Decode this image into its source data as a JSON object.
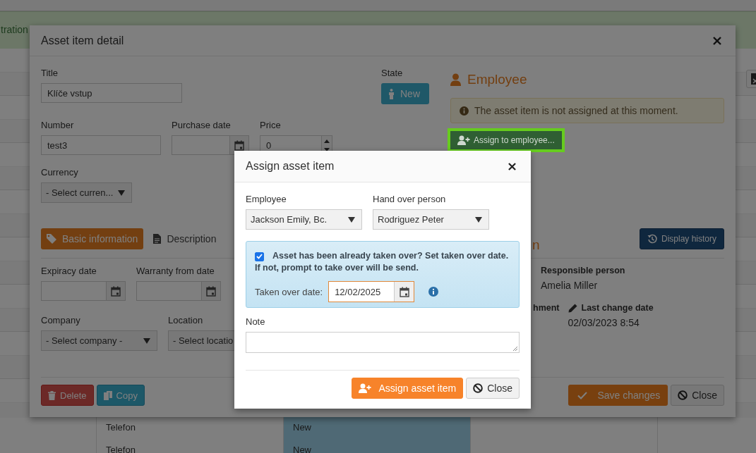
{
  "background": {
    "banner_text": "tration",
    "table_rows": [
      {
        "name": "Telefon",
        "state": "New"
      },
      {
        "name": "Telefon",
        "state": "New"
      }
    ]
  },
  "detail": {
    "title": "Asset item detail",
    "title_field": {
      "label": "Title",
      "value": "Klíče vstup"
    },
    "state": {
      "label": "State",
      "value": "New"
    },
    "number": {
      "label": "Number",
      "value": "test3"
    },
    "purchase_date": {
      "label": "Purchase date"
    },
    "price": {
      "label": "Price",
      "value": "0"
    },
    "currency": {
      "label": "Currency",
      "value": "- Select curren..."
    },
    "employee": {
      "heading": "Employee",
      "alert": "The asset item is not assigned at this moment.",
      "assign_button": "Assign to employee...",
      "highlighted": true
    },
    "tabs": [
      {
        "label": "Basic information",
        "selected": true
      },
      {
        "label": "Description",
        "selected": false
      }
    ],
    "history_button": "Display history",
    "dates": [
      {
        "label": "Expiracy date"
      },
      {
        "label": "Warranty from date"
      }
    ],
    "company": {
      "label": "Company",
      "value": "- Select company -"
    },
    "location": {
      "label": "Location",
      "value": "- Select locatio"
    },
    "section_heading": "n",
    "responsible": {
      "label": "Responsible person",
      "value": "Amelia Miller"
    },
    "attachment_label": "hment",
    "last_change": {
      "label": "Last change date",
      "value": "02/03/2023 8:54"
    },
    "buttons": {
      "delete": "Delete",
      "copy": "Copy",
      "save": "Save changes",
      "close": "Close"
    }
  },
  "assign": {
    "title": "Assign asset item",
    "employee": {
      "label": "Employee",
      "value": "Jackson Emily, Bc."
    },
    "hand_over": {
      "label": "Hand over person",
      "value": "Rodriguez Peter"
    },
    "taken_over": {
      "checked": true,
      "lines": [
        "Asset has been already taken over? Set taken over date.",
        "If not, prompt to take over will be send."
      ],
      "date_label": "Taken over date:",
      "date_value": "12/02/2025"
    },
    "note": {
      "label": "Note"
    },
    "buttons": {
      "assign": "Assign asset item",
      "close": "Close"
    }
  }
}
